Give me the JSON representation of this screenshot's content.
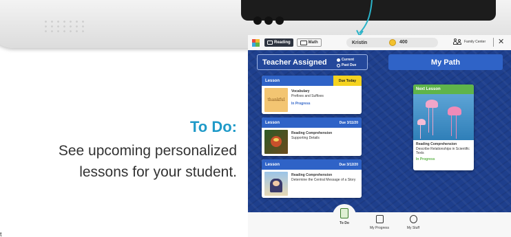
{
  "marketing": {
    "title": "To Do:",
    "description": "See upcoming personalized lessons for your student.",
    "corner": "t"
  },
  "topbar": {
    "subjects": [
      {
        "label": "Reading",
        "icon": "book-icon",
        "active": true
      },
      {
        "label": "Math",
        "icon": "calculator-icon",
        "active": false
      }
    ],
    "student_name": "Kristin",
    "coins": "400",
    "family_center": "Family Center",
    "close_icon": "close-icon"
  },
  "teacher_assigned": {
    "title": "Teacher Assigned",
    "filters": [
      {
        "label": "Current",
        "selected": true
      },
      {
        "label": "Past Due",
        "selected": false
      }
    ],
    "lessons": [
      {
        "header": "Lesson",
        "due": "Due Today",
        "type": "Vocabulary",
        "topic": "Prefixes and Suffixes",
        "status": "In Progress",
        "thumb_word": "thankful"
      },
      {
        "header": "Lesson",
        "due": "Due 3/11/20",
        "type": "Reading Comprehension",
        "topic": "Supporting Details",
        "status": ""
      },
      {
        "header": "Lesson",
        "due": "Due 3/12/20",
        "type": "Reading Comprehension",
        "topic": "Determine the Central Message of a Story",
        "status": ""
      }
    ]
  },
  "my_path": {
    "title": "My Path",
    "next_lesson": {
      "header": "Next Lesson",
      "type": "Reading Comprehension",
      "topic": "Describe Relationships in Scientific Texts",
      "status": "In Progress"
    }
  },
  "bottom_nav": [
    {
      "label": "To Do",
      "icon": "checklist-icon",
      "active": true
    },
    {
      "label": "My Progress",
      "icon": "progress-chart-icon",
      "active": false
    },
    {
      "label": "My Stuff",
      "icon": "smiley-icon",
      "active": false
    }
  ],
  "colors": {
    "accent_blue": "#2f63c7",
    "background_blue": "#1e3f8d",
    "due_today_yellow": "#f5d320",
    "next_lesson_green": "#5fb44a",
    "marketing_title": "#1f9ac8"
  }
}
